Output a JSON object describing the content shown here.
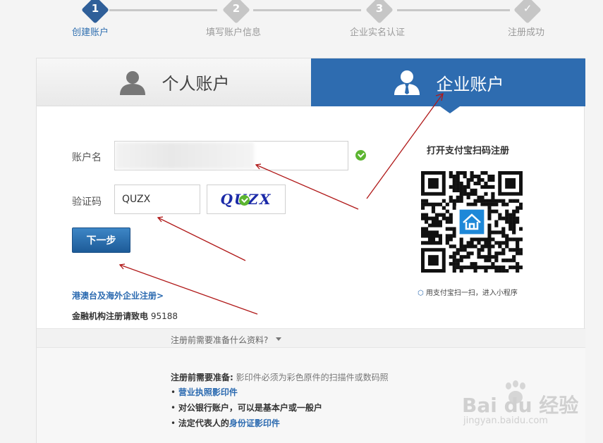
{
  "steps": [
    {
      "num": "1",
      "label": "创建账户",
      "active": true
    },
    {
      "num": "2",
      "label": "填写账户信息",
      "active": false
    },
    {
      "num": "3",
      "label": "企业实名认证",
      "active": false
    },
    {
      "num": "✓",
      "label": "注册成功",
      "active": false
    }
  ],
  "tabs": {
    "personal": "个人账户",
    "enterprise": "企业账户"
  },
  "form": {
    "account_label": "账户名",
    "account_value": "",
    "captcha_label": "验证码",
    "captcha_value": "QUZX",
    "captcha_image_text": "QUZX",
    "next_button": "下一步"
  },
  "links": {
    "overseas": "港澳台及海外企业注册>",
    "finance_prefix": "金融机构注册请致电",
    "finance_phone": "95188"
  },
  "qr": {
    "title": "打开支付宝扫码注册",
    "hint": "用支付宝扫一扫，进入小程序"
  },
  "faq": {
    "title": "注册前需要准备什么资料?",
    "prep_title": "注册前需要准备:",
    "prep_note": "影印件必须为彩色原件的扫描件或数码照",
    "item1": "营业执照影印件",
    "item2": "对公银行账户，可以是基本户或一般户",
    "item3_prefix": "法定代表人的",
    "item3_link": "身份证影印件"
  },
  "watermark": {
    "brand": "Bai du 经验",
    "url": "jingyan.baidu.com"
  },
  "colors": {
    "primary": "#2e6cb0",
    "success": "#5cb531",
    "annotation": "#b01818"
  }
}
